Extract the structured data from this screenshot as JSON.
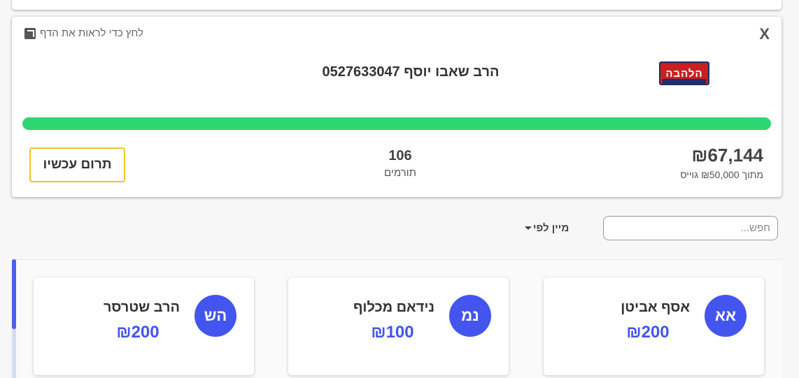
{
  "campaign": {
    "close_label": "X",
    "page_link_label": "לחץ כדי לראות את הדף",
    "logo_text": "הלהבה",
    "title": "הרב שאבו יוסף 0527633047",
    "progress_fraction": 1.0,
    "progress_color": "#2ed671",
    "raised_amount": "₪67,144",
    "goal_text": "מתוך ₪50,000 גוייס",
    "donors_count": "106",
    "donors_label": "תורמים",
    "donate_button_label": "תרום עכשיו",
    "donate_button_border_color": "#f2c12e"
  },
  "controls": {
    "search_placeholder": "חפש...",
    "sort_label": "מיין לפי"
  },
  "donors": [
    {
      "initials": "אא",
      "name": "אסף אביטן",
      "amount": "₪200"
    },
    {
      "initials": "נמ",
      "name": "נידאם מכלוף",
      "amount": "₪100"
    },
    {
      "initials": "הש",
      "name": "הרב שטרסר",
      "amount": "₪200"
    }
  ],
  "accent_color": "#4355ee",
  "icons": {
    "page_link": "external-link-icon",
    "sort": "caret-down-icon"
  }
}
